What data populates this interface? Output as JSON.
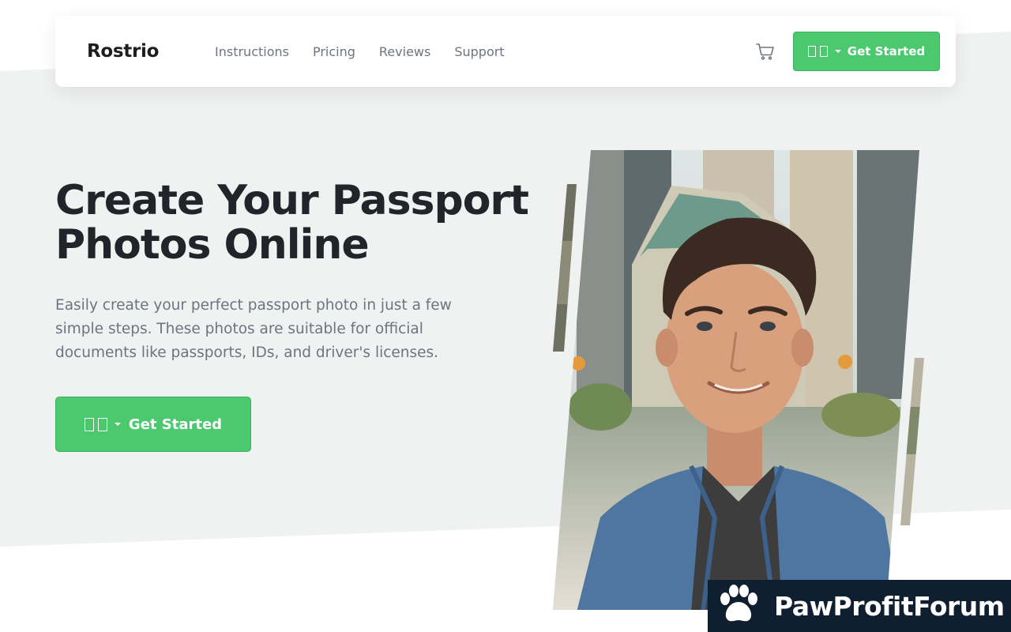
{
  "brand": {
    "name": "Rostrio"
  },
  "nav": {
    "links": [
      {
        "label": "Instructions"
      },
      {
        "label": "Pricing"
      },
      {
        "label": "Reviews"
      },
      {
        "label": "Support"
      }
    ],
    "cart_icon": "cart-icon",
    "cta_label": "Get Started",
    "language_icon": "language-selector"
  },
  "hero": {
    "title": "Create Your Passport Photos Online",
    "description": "Easily create your perfect passport photo in just a few simple steps. These photos are suitable for official documents like passports, IDs, and driver's licenses.",
    "cta_label": "Get Started",
    "image": "smiling-man-city-street-photo"
  },
  "watermark": {
    "text": "PawProfitForum",
    "icon": "paw-icon"
  },
  "colors": {
    "accent": "#4cc86f",
    "hero_bg": "#f0f1f1",
    "text_dark": "#212529",
    "text_muted": "#6c757d",
    "badge_bg": "#0f1f2f"
  }
}
